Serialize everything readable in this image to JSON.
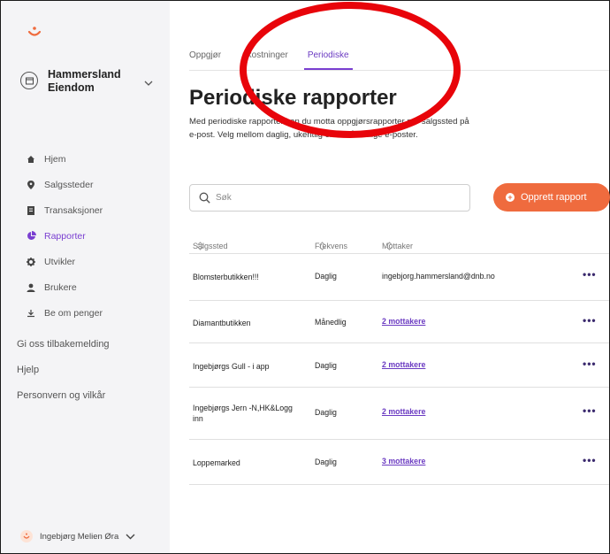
{
  "sidebar": {
    "logo_icon": "smile-icon",
    "account_name": "Hammersland Eiendom",
    "nav": [
      {
        "label": "Hjem",
        "icon": "home-icon",
        "active": false
      },
      {
        "label": "Salgssteder",
        "icon": "location-pin-icon",
        "active": false
      },
      {
        "label": "Transaksjoner",
        "icon": "receipt-icon",
        "active": false
      },
      {
        "label": "Rapporter",
        "icon": "pie-chart-icon",
        "active": true
      },
      {
        "label": "Utvikler",
        "icon": "gear-icon",
        "active": false
      },
      {
        "label": "Brukere",
        "icon": "user-icon",
        "active": false
      },
      {
        "label": "Be om penger",
        "icon": "download-arrow-icon",
        "active": false
      }
    ],
    "links": [
      "Gi oss tilbakemelding",
      "Hjelp",
      "Personvern og vilkår"
    ],
    "user_name": "Ingebjørg Melien Øra"
  },
  "main": {
    "tabs": [
      {
        "label": "Oppgjør",
        "active": false
      },
      {
        "label": "nkostninger",
        "active": false
      },
      {
        "label": "Periodiske",
        "active": true
      }
    ],
    "title": "Periodiske rapporter",
    "description": "Med periodiske rapporter kan du motta oppgjørsrapporter per salgssted på e-post. Velg mellom daglig, ukentlig eller månedlige e-poster.",
    "search_placeholder": "Søk",
    "create_button": "Opprett rapport",
    "columns": [
      "Salgssted",
      "Frekvens",
      "Mottaker"
    ],
    "rows": [
      {
        "location": "Blomsterbutikken!!!",
        "frequency": "Daglig",
        "recipient": "ingebjorg.hammersland@dnb.no",
        "is_link": false
      },
      {
        "location": "Diamantbutikken",
        "frequency": "Månedlig",
        "recipient": "2 mottakere",
        "is_link": true
      },
      {
        "location": "Ingebjørgs Gull - i app",
        "frequency": "Daglig",
        "recipient": "2 mottakere",
        "is_link": true
      },
      {
        "location": "Ingebjørgs Jern -N,HK&Logg inn",
        "frequency": "Daglig",
        "recipient": "2 mottakere",
        "is_link": true
      },
      {
        "location": "Loppemarked",
        "frequency": "Daglig",
        "recipient": "3 mottakere",
        "is_link": true
      }
    ],
    "row_menu": "•••"
  },
  "colors": {
    "accent": "#7a3fd1",
    "button": "#ef6b3e",
    "annotation": "#e8040a"
  }
}
